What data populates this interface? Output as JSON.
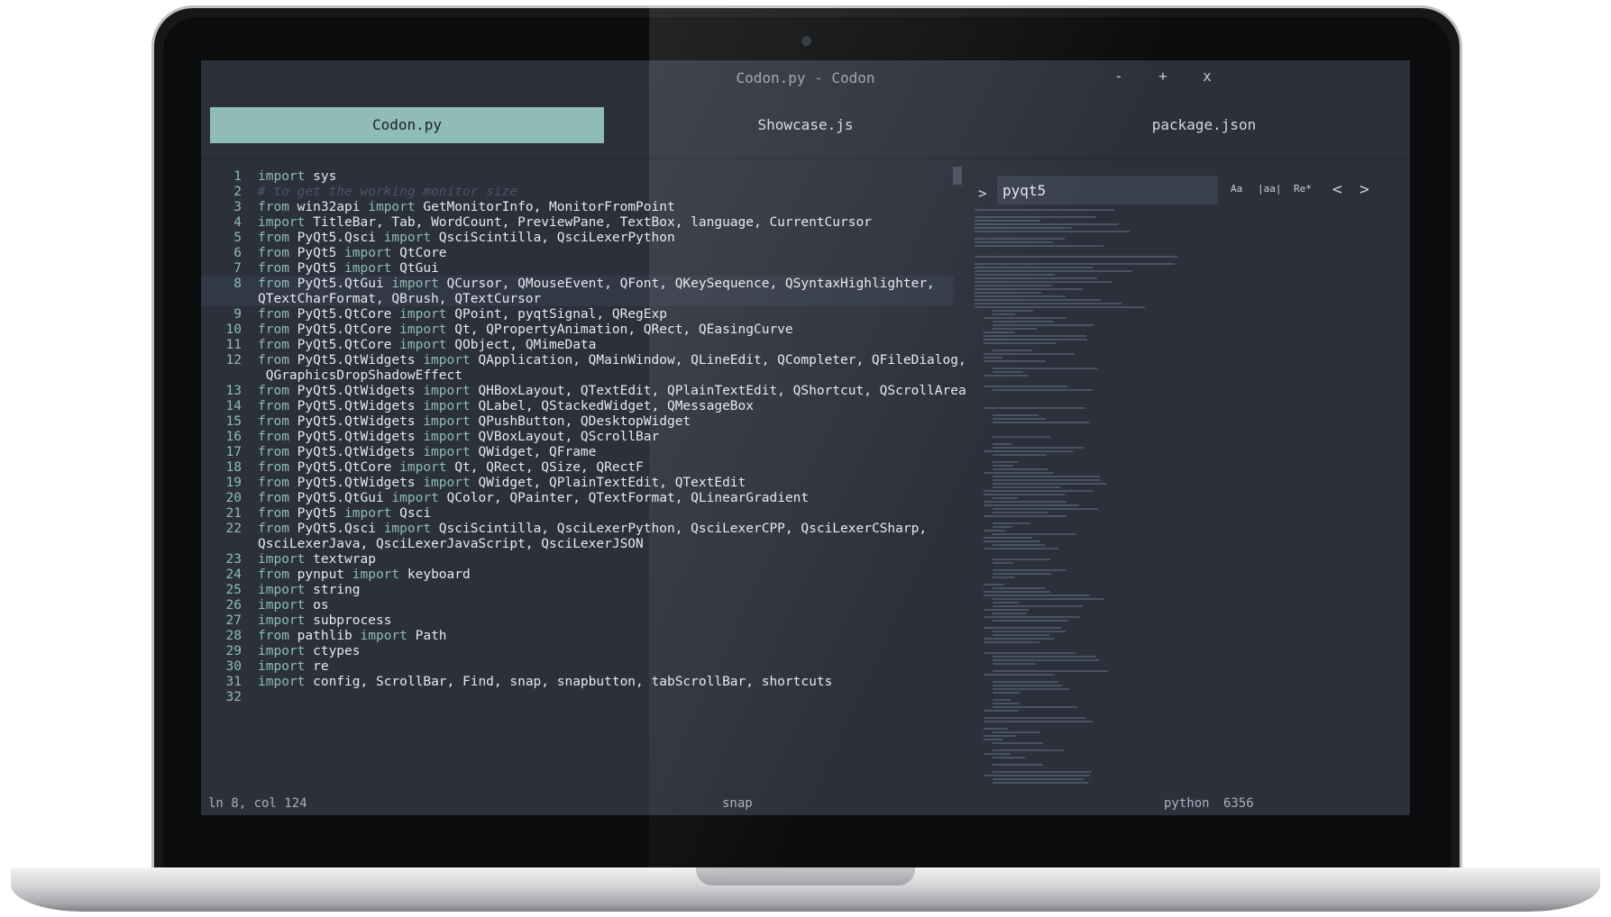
{
  "window": {
    "title": "Codon.py - Codon",
    "minimize": "-",
    "maximize": "+",
    "close": "x"
  },
  "tabs": [
    {
      "label": "Codon.py",
      "active": true
    },
    {
      "label": "Showcase.js",
      "active": false
    },
    {
      "label": "package.json",
      "active": false
    }
  ],
  "code_lines": [
    {
      "n": "1",
      "tokens": [
        [
          "kw",
          "import"
        ],
        [
          "t",
          " sys"
        ]
      ]
    },
    {
      "n": "2",
      "tokens": [
        [
          "cm",
          "# to get the working monitor size"
        ]
      ]
    },
    {
      "n": "3",
      "tokens": [
        [
          "kw",
          "from"
        ],
        [
          "t",
          " win32api "
        ],
        [
          "kw",
          "import"
        ],
        [
          "t",
          " GetMonitorInfo, MonitorFromPoint"
        ]
      ]
    },
    {
      "n": "4",
      "tokens": [
        [
          "kw",
          "import"
        ],
        [
          "t",
          " TitleBar, Tab, WordCount, PreviewPane, TextBox, language, CurrentCursor"
        ]
      ]
    },
    {
      "n": "5",
      "tokens": [
        [
          "kw",
          "from"
        ],
        [
          "t",
          " PyQt5.Qsci "
        ],
        [
          "kw",
          "import"
        ],
        [
          "t",
          " QsciScintilla, QsciLexerPython"
        ]
      ]
    },
    {
      "n": "6",
      "tokens": [
        [
          "kw",
          "from"
        ],
        [
          "t",
          " PyQt5 "
        ],
        [
          "kw",
          "import"
        ],
        [
          "t",
          " QtCore"
        ]
      ]
    },
    {
      "n": "7",
      "tokens": [
        [
          "kw",
          "from"
        ],
        [
          "t",
          " PyQt5 "
        ],
        [
          "kw",
          "import"
        ],
        [
          "t",
          " QtGui"
        ]
      ]
    },
    {
      "n": "8",
      "tokens": [
        [
          "kw",
          "from"
        ],
        [
          "t",
          " PyQt5.QtGui "
        ],
        [
          "kw",
          "import"
        ],
        [
          "t",
          " QCursor, QMouseEvent, QFont, QKeySequence, QSyntaxHighlighter,"
        ]
      ],
      "current": true
    },
    {
      "n": "",
      "tokens": [
        [
          "t",
          "QTextCharFormat, QBrush, QTextCursor"
        ]
      ],
      "current": true
    },
    {
      "n": "9",
      "tokens": [
        [
          "kw",
          "from"
        ],
        [
          "t",
          " PyQt5.QtCore "
        ],
        [
          "kw",
          "import"
        ],
        [
          "t",
          " QPoint, pyqtSignal, QRegExp"
        ]
      ]
    },
    {
      "n": "10",
      "tokens": [
        [
          "kw",
          "from"
        ],
        [
          "t",
          " PyQt5.QtCore "
        ],
        [
          "kw",
          "import"
        ],
        [
          "t",
          " Qt, QPropertyAnimation, QRect, QEasingCurve"
        ]
      ]
    },
    {
      "n": "11",
      "tokens": [
        [
          "kw",
          "from"
        ],
        [
          "t",
          " PyQt5.QtCore "
        ],
        [
          "kw",
          "import"
        ],
        [
          "t",
          " QObject, QMimeData"
        ]
      ]
    },
    {
      "n": "12",
      "tokens": [
        [
          "kw",
          "from"
        ],
        [
          "t",
          " PyQt5.QtWidgets "
        ],
        [
          "kw",
          "import"
        ],
        [
          "t",
          " QApplication, QMainWindow, QLineEdit, QCompleter, QFileDialog,"
        ]
      ]
    },
    {
      "n": "",
      "tokens": [
        [
          "t",
          " QGraphicsDropShadowEffect"
        ]
      ]
    },
    {
      "n": "13",
      "tokens": [
        [
          "kw",
          "from"
        ],
        [
          "t",
          " PyQt5.QtWidgets "
        ],
        [
          "kw",
          "import"
        ],
        [
          "t",
          " QHBoxLayout, QTextEdit, QPlainTextEdit, QShortcut, QScrollArea"
        ]
      ]
    },
    {
      "n": "14",
      "tokens": [
        [
          "kw",
          "from"
        ],
        [
          "t",
          " PyQt5.QtWidgets "
        ],
        [
          "kw",
          "import"
        ],
        [
          "t",
          " QLabel, QStackedWidget, QMessageBox"
        ]
      ]
    },
    {
      "n": "15",
      "tokens": [
        [
          "kw",
          "from"
        ],
        [
          "t",
          " PyQt5.QtWidgets "
        ],
        [
          "kw",
          "import"
        ],
        [
          "t",
          " QPushButton, QDesktopWidget"
        ]
      ]
    },
    {
      "n": "16",
      "tokens": [
        [
          "kw",
          "from"
        ],
        [
          "t",
          " PyQt5.QtWidgets "
        ],
        [
          "kw",
          "import"
        ],
        [
          "t",
          " QVBoxLayout, QScrollBar"
        ]
      ]
    },
    {
      "n": "17",
      "tokens": [
        [
          "kw",
          "from"
        ],
        [
          "t",
          " PyQt5.QtWidgets "
        ],
        [
          "kw",
          "import"
        ],
        [
          "t",
          " QWidget, QFrame"
        ]
      ]
    },
    {
      "n": "18",
      "tokens": [
        [
          "kw",
          "from"
        ],
        [
          "t",
          " PyQt5.QtCore "
        ],
        [
          "kw",
          "import"
        ],
        [
          "t",
          " Qt, QRect, QSize, QRectF"
        ]
      ]
    },
    {
      "n": "19",
      "tokens": [
        [
          "kw",
          "from"
        ],
        [
          "t",
          " PyQt5.QtWidgets "
        ],
        [
          "kw",
          "import"
        ],
        [
          "t",
          " QWidget, QPlainTextEdit, QTextEdit"
        ]
      ]
    },
    {
      "n": "20",
      "tokens": [
        [
          "kw",
          "from"
        ],
        [
          "t",
          " PyQt5.QtGui "
        ],
        [
          "kw",
          "import"
        ],
        [
          "t",
          " QColor, QPainter, QTextFormat, QLinearGradient"
        ]
      ]
    },
    {
      "n": "21",
      "tokens": [
        [
          "kw",
          "from"
        ],
        [
          "t",
          " PyQt5 "
        ],
        [
          "kw",
          "import"
        ],
        [
          "t",
          " Qsci"
        ]
      ]
    },
    {
      "n": "22",
      "tokens": [
        [
          "kw",
          "from"
        ],
        [
          "t",
          " PyQt5.Qsci "
        ],
        [
          "kw",
          "import"
        ],
        [
          "t",
          " QsciScintilla, QsciLexerPython, QsciLexerCPP, QsciLexerCSharp,"
        ]
      ]
    },
    {
      "n": "",
      "tokens": [
        [
          "t",
          "QsciLexerJava, QsciLexerJavaScript, QsciLexerJSON"
        ]
      ]
    },
    {
      "n": "23",
      "tokens": [
        [
          "kw",
          "import"
        ],
        [
          "t",
          " textwrap"
        ]
      ]
    },
    {
      "n": "24",
      "tokens": [
        [
          "kw",
          "from"
        ],
        [
          "t",
          " pynput "
        ],
        [
          "kw",
          "import"
        ],
        [
          "t",
          " keyboard"
        ]
      ]
    },
    {
      "n": "25",
      "tokens": [
        [
          "kw",
          "import"
        ],
        [
          "t",
          " string"
        ]
      ]
    },
    {
      "n": "26",
      "tokens": [
        [
          "kw",
          "import"
        ],
        [
          "t",
          " os"
        ]
      ]
    },
    {
      "n": "27",
      "tokens": [
        [
          "kw",
          "import"
        ],
        [
          "t",
          " subprocess"
        ]
      ]
    },
    {
      "n": "28",
      "tokens": [
        [
          "kw",
          "from"
        ],
        [
          "t",
          " pathlib "
        ],
        [
          "kw",
          "import"
        ],
        [
          "t",
          " Path"
        ]
      ]
    },
    {
      "n": "29",
      "tokens": [
        [
          "kw",
          "import"
        ],
        [
          "t",
          " ctypes"
        ]
      ]
    },
    {
      "n": "30",
      "tokens": [
        [
          "kw",
          "import"
        ],
        [
          "t",
          " re"
        ]
      ]
    },
    {
      "n": "31",
      "tokens": [
        [
          "kw",
          "import"
        ],
        [
          "t",
          " config, ScrollBar, Find, snap, snapbutton, tabScrollBar, shortcuts"
        ]
      ]
    },
    {
      "n": "32",
      "tokens": []
    }
  ],
  "find": {
    "query": "pyqt5",
    "chevron": ">",
    "match_case": "Aa",
    "whole_word": "|aa|",
    "regex": "Re*",
    "prev": "<",
    "next": ">"
  },
  "status": {
    "position": "ln 8, col 124",
    "center": "snap",
    "language": "python",
    "count": "6356"
  },
  "colors": {
    "accent": "#8fbcb5",
    "background": "#2b303b",
    "comment": "#4c5566"
  }
}
